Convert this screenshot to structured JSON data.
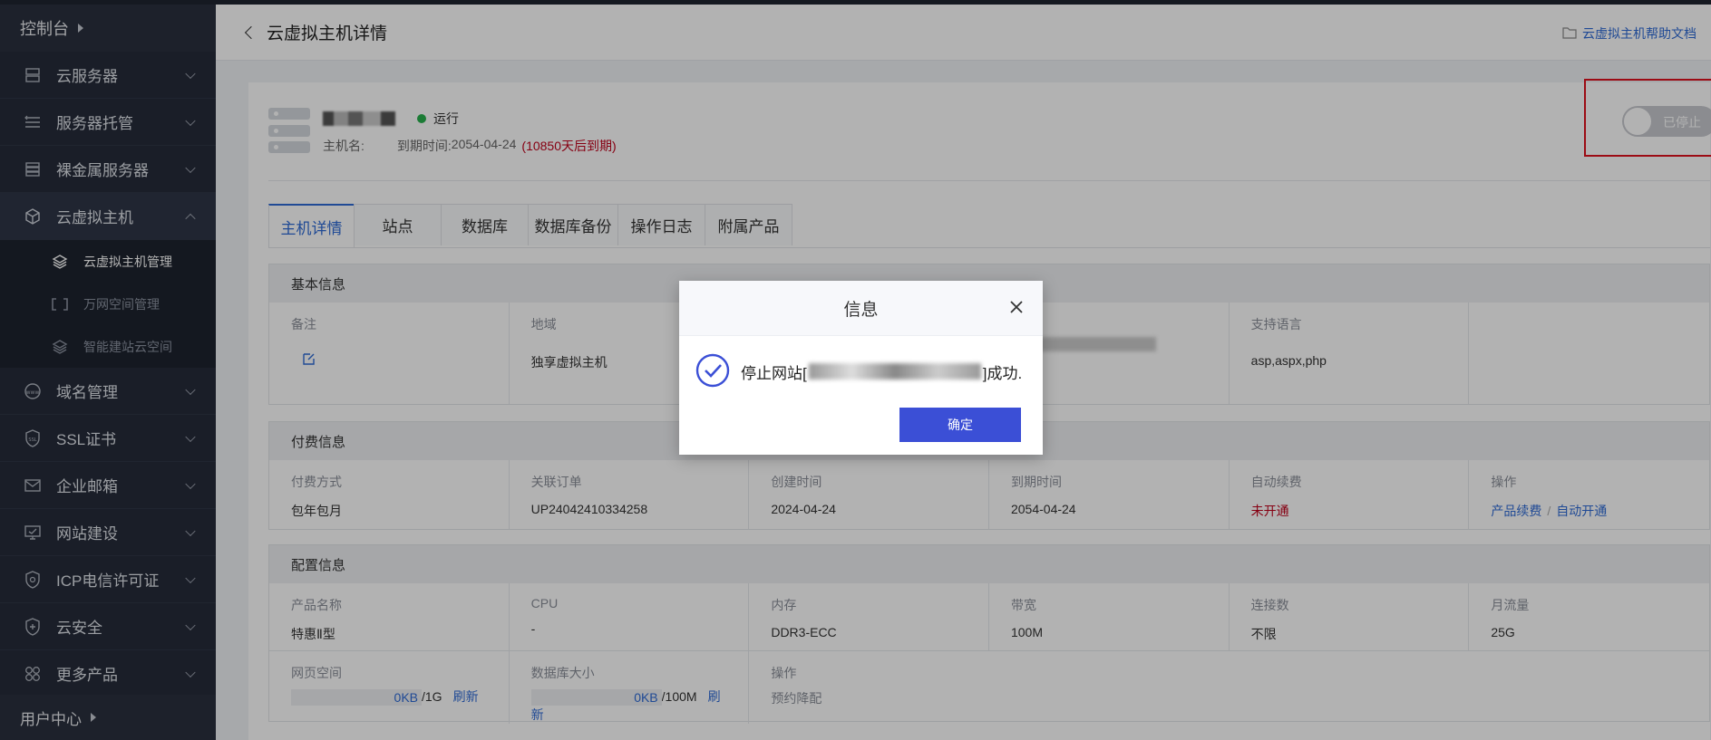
{
  "sidebar": {
    "header": "控制台",
    "items": [
      {
        "label": "云服务器",
        "icon": "server-icon"
      },
      {
        "label": "服务器托管",
        "icon": "hosting-icon"
      },
      {
        "label": "裸金属服务器",
        "icon": "baremetal-icon"
      },
      {
        "label": "云虚拟主机",
        "icon": "cube-icon"
      },
      {
        "label": "域名管理",
        "icon": "www-icon"
      },
      {
        "label": "SSL证书",
        "icon": "ssl-icon"
      },
      {
        "label": "企业邮箱",
        "icon": "mail-icon"
      },
      {
        "label": "网站建设",
        "icon": "monitor-icon"
      },
      {
        "label": "ICP电信许可证",
        "icon": "shield-icon"
      },
      {
        "label": "云安全",
        "icon": "security-icon"
      },
      {
        "label": "更多产品",
        "icon": "grid-icon"
      }
    ],
    "subitems": [
      {
        "label": "云虚拟主机管理"
      },
      {
        "label": "万网空间管理"
      },
      {
        "label": "智能建站云空间"
      }
    ],
    "footer": "用户中心"
  },
  "header": {
    "title": "云虚拟主机详情",
    "help": "云虚拟主机帮助文档"
  },
  "host": {
    "status": "运行",
    "hostname_label": "主机名:",
    "expire_label": "到期时间:",
    "expire_date": "2054-04-24",
    "expire_note": "(10850天后到期)",
    "toggle_label": "已停止"
  },
  "tabs": [
    "主机详情",
    "站点",
    "数据库",
    "数据库备份",
    "操作日志",
    "附属产品"
  ],
  "basic": {
    "title": "基本信息",
    "remark_label": "备注",
    "region_label": "地域",
    "region_value": "独享虚拟主机",
    "lang_label": "支持语言",
    "lang_value": "asp,aspx,php"
  },
  "pay": {
    "title": "付费信息",
    "method_label": "付费方式",
    "method_value": "包年包月",
    "order_label": "关联订单",
    "order_value": "UP24042410334258",
    "created_label": "创建时间",
    "created_value": "2024-04-24",
    "expire_label": "到期时间",
    "expire_value": "2054-04-24",
    "renew_label": "自动续费",
    "renew_value": "未开通",
    "action_label": "操作",
    "action_renew": "产品续费",
    "action_sep": "/",
    "action_auto": "自动开通"
  },
  "config": {
    "title": "配置信息",
    "product_label": "产品名称",
    "product_value": "特惠Ⅱ型",
    "cpu_label": "CPU",
    "cpu_value": "-",
    "mem_label": "内存",
    "mem_value": "DDR3-ECC",
    "bw_label": "带宽",
    "bw_value": "100M",
    "conn_label": "连接数",
    "conn_value": "不限",
    "traffic_label": "月流量",
    "traffic_value": "25G",
    "web_label": "网页空间",
    "web_used": "0KB",
    "web_total": "/1G",
    "web_refresh": "刷新",
    "db_label": "数据库大小",
    "db_used": "0KB",
    "db_total": "/100M",
    "db_refresh": "刷新",
    "op_label": "操作",
    "op_value": "预约降配"
  },
  "dialog": {
    "title": "信息",
    "msg_prefix": "停止网站[",
    "msg_suffix": "]成功.",
    "ok": "确定"
  },
  "colors": {
    "accent": "#2f6bd6",
    "danger": "#c0001a",
    "running": "#27b04c",
    "button": "#3b4fd6"
  }
}
